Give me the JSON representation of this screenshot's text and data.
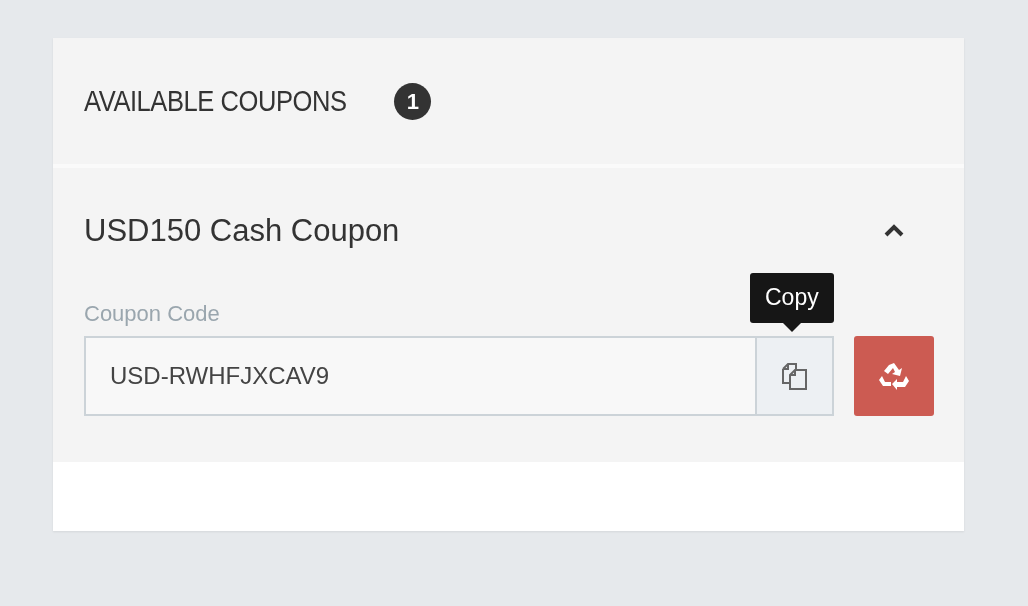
{
  "panel": {
    "title": "AVAILABLE COUPONS",
    "count": "1"
  },
  "coupons": [
    {
      "title": "USD150 Cash Coupon",
      "expanded": true,
      "field_label": "Coupon Code",
      "code": "USD-RWHFJXCAV9",
      "tooltip": "Copy"
    }
  ]
}
